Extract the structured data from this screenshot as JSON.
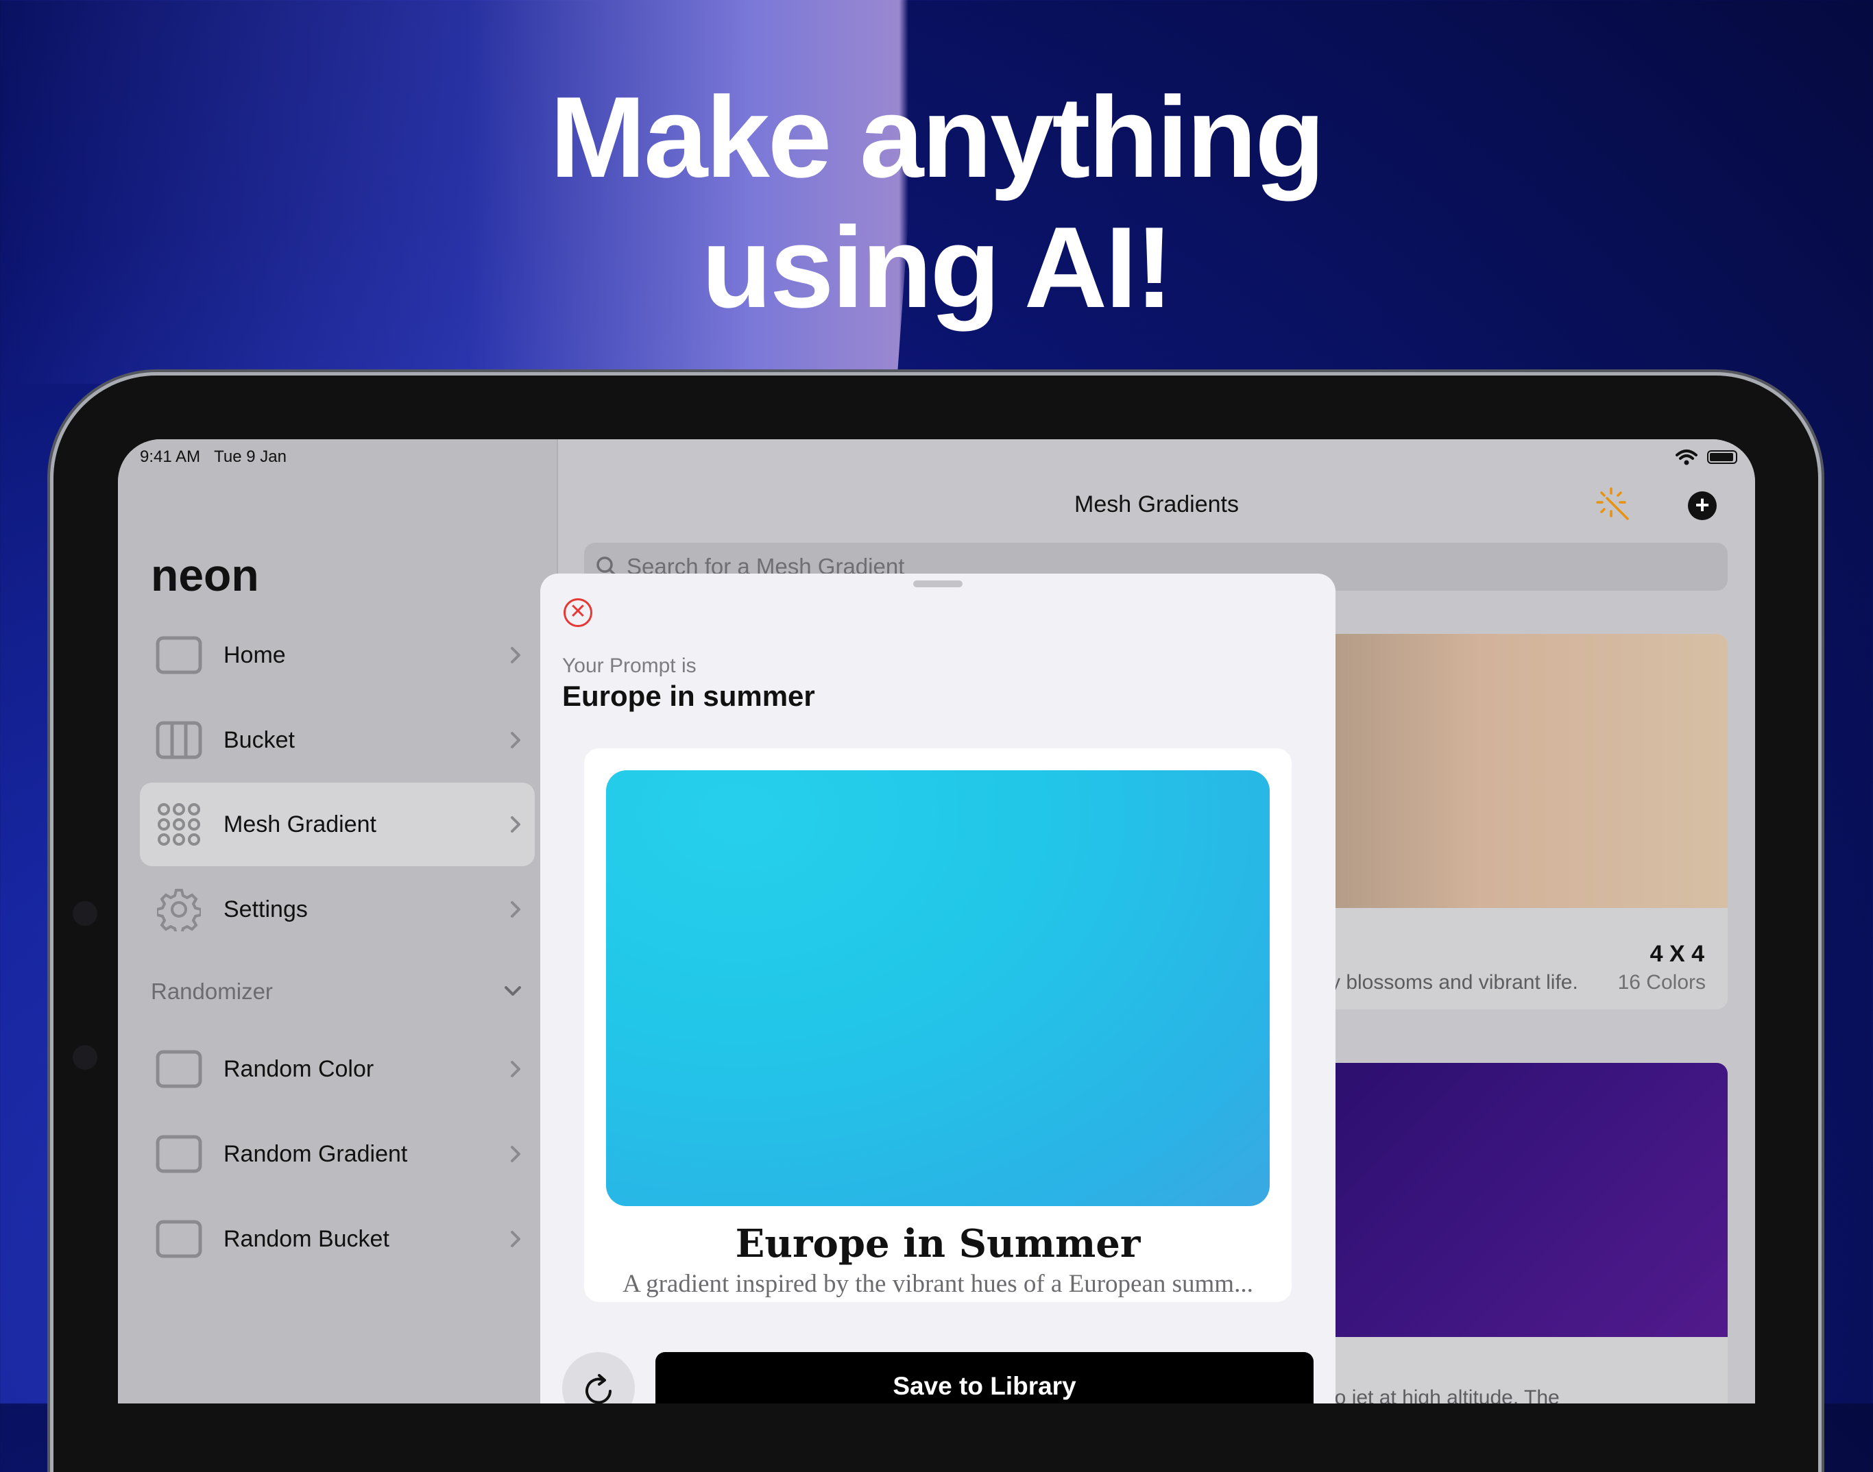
{
  "headline": {
    "line1": "Make anything",
    "line2": "using AI!"
  },
  "status_bar": {
    "time": "9:41 AM",
    "date": "Tue 9 Jan"
  },
  "sidebar": {
    "app_title": "neon",
    "items": [
      {
        "label": "Home",
        "icon": "square-icon"
      },
      {
        "label": "Bucket",
        "icon": "columns-icon"
      },
      {
        "label": "Mesh Gradient",
        "icon": "dot-grid-icon",
        "selected": true
      },
      {
        "label": "Settings",
        "icon": "gear-icon"
      }
    ],
    "section_title": "Randomizer",
    "random_items": [
      {
        "label": "Random Color",
        "icon": "square-icon"
      },
      {
        "label": "Random Gradient",
        "icon": "square-icon"
      },
      {
        "label": "Random Bucket",
        "icon": "square-icon"
      }
    ]
  },
  "main": {
    "title": "Mesh Gradients",
    "search": {
      "placeholder": "Search for a Mesh Gradient"
    },
    "cards": [
      {
        "size": "4 X 4",
        "description": "rry blossoms and vibrant life.",
        "colors": "16 Colors"
      },
      {
        "description": "rdo jet at high altitude. The"
      }
    ]
  },
  "sheet": {
    "prompt_label": "Your Prompt is",
    "prompt_value": "Europe in summer",
    "preview": {
      "title": "Europe in Summer",
      "description": "A gradient inspired by the vibrant hues of a European summ..."
    },
    "save_label": "Save to Library"
  },
  "colors": {
    "accent_orange": "#e8920f",
    "close_red": "#e53935",
    "preview_cyan": "#22c6e8"
  }
}
